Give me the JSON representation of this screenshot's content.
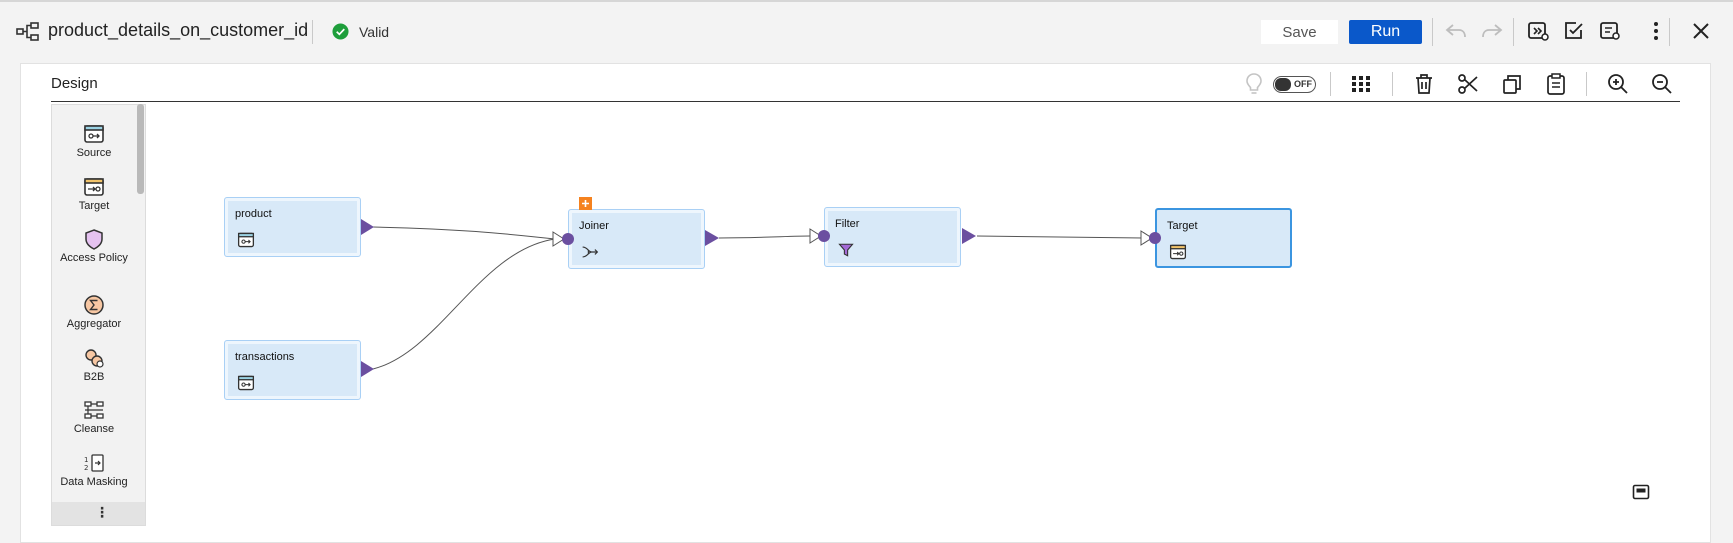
{
  "header": {
    "title": "product_details_on_customer_id",
    "status": "Valid",
    "save_label": "Save",
    "run_label": "Run"
  },
  "canvas": {
    "title": "Design",
    "toggle_label": "OFF"
  },
  "palette": {
    "items": [
      {
        "label": "Source",
        "icon": "source-icon"
      },
      {
        "label": "Target",
        "icon": "target-icon"
      },
      {
        "label": "Access Policy",
        "icon": "shield-icon"
      },
      {
        "label": "Aggregator",
        "icon": "sigma-icon"
      },
      {
        "label": "B2B",
        "icon": "b2b-icon"
      },
      {
        "label": "Cleanse",
        "icon": "cleanse-icon"
      },
      {
        "label": "Data Masking",
        "icon": "data-masking-icon"
      }
    ]
  },
  "nodes": [
    {
      "label": "product",
      "icon": "source-icon"
    },
    {
      "label": "transactions",
      "icon": "source-icon"
    },
    {
      "label": "Joiner",
      "icon": "joiner-icon"
    },
    {
      "label": "Filter",
      "icon": "funnel-icon"
    },
    {
      "label": "Target",
      "icon": "target-icon"
    }
  ],
  "colors": {
    "run_button": "#0a58ca",
    "node_fill": "#d8e9f8",
    "node_border": "#a9d0f5",
    "port": "#6b4fa0",
    "valid": "#1e9e3b",
    "warning_badge": "#f5821f"
  }
}
